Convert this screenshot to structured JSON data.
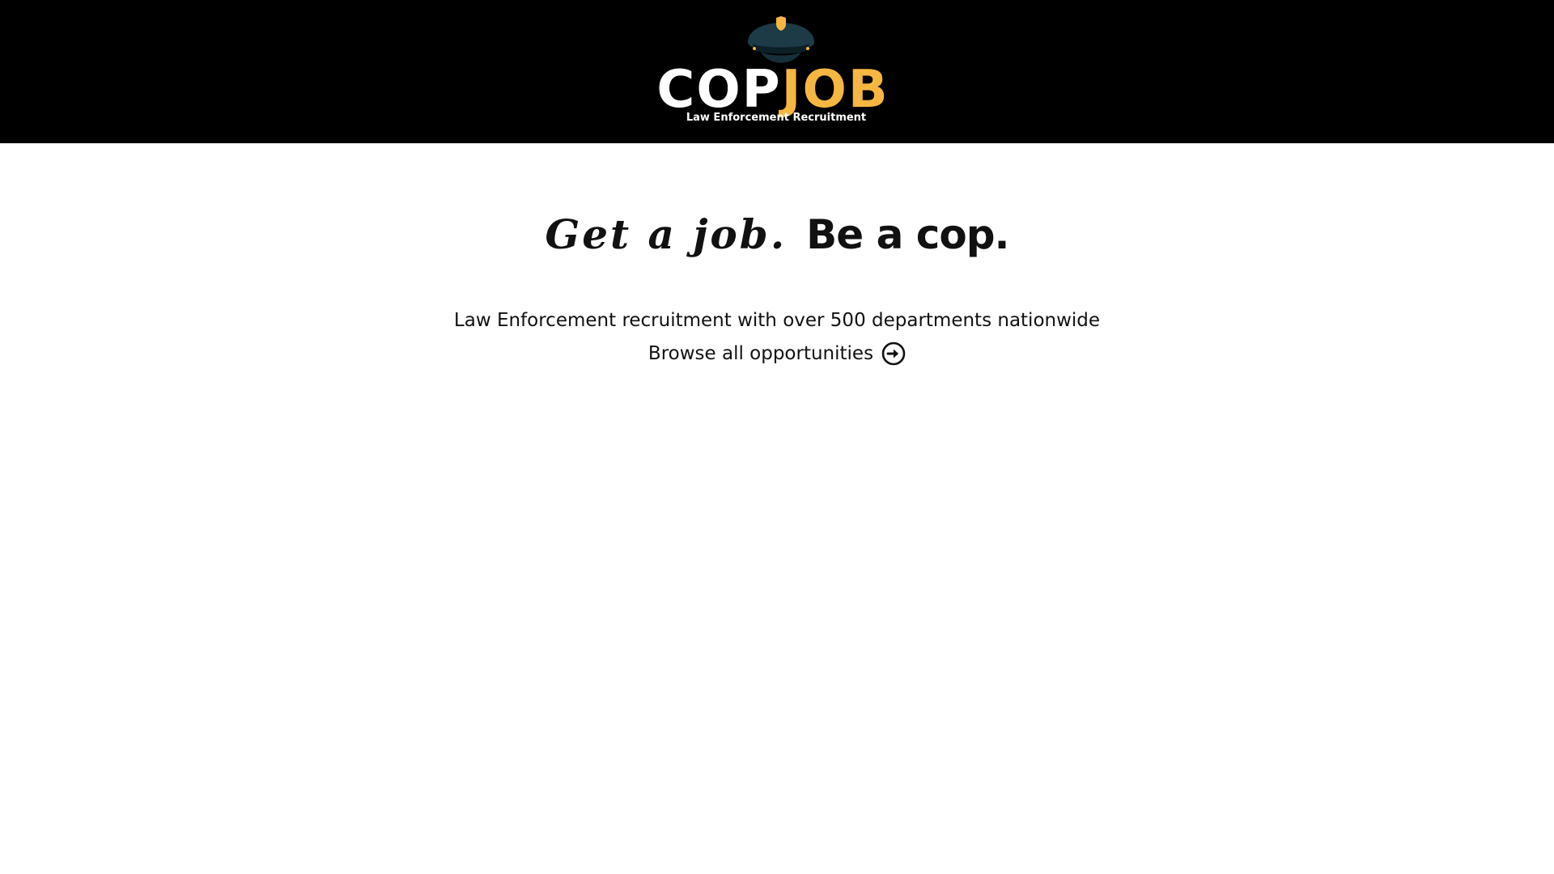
{
  "header": {
    "logo": {
      "word_cop": "COP",
      "word_job": "JOB",
      "tagline": "Law Enforcement Recruitment",
      "icon": "police-cap-icon"
    }
  },
  "hero": {
    "headline_script": "Get a job.",
    "headline_bold": "Be a cop.",
    "subtitle": "Law Enforcement recruitment with over 500 departments nationwide",
    "browse_label": "Browse all opportunities",
    "browse_icon": "circle-arrow-right-icon"
  },
  "colors": {
    "header_bg": "#000000",
    "accent": "#f5b642",
    "cap": "#1d3a47",
    "text": "#111111"
  }
}
